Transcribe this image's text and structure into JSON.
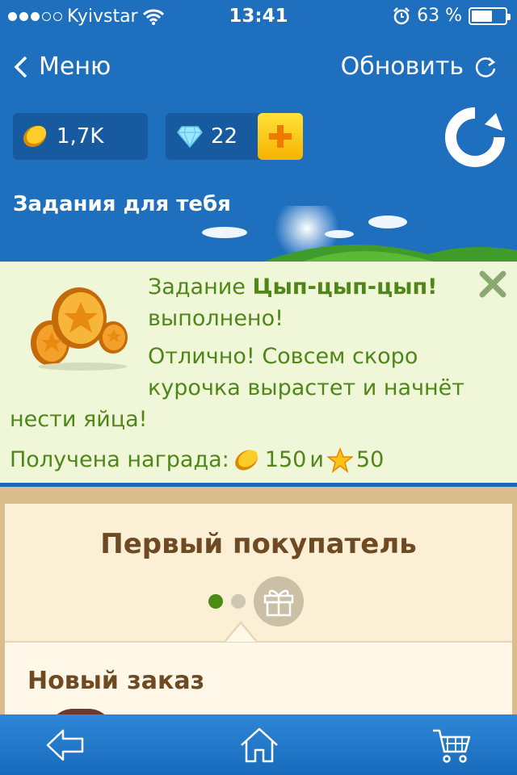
{
  "status": {
    "carrier": "Kyivstar",
    "time": "13:41",
    "battery": "63 %",
    "battery_level": 0.63
  },
  "nav": {
    "back_label": "Меню",
    "refresh_label": "Обновить"
  },
  "currency": {
    "coins": "1,7K",
    "gems": "22"
  },
  "section": {
    "title": "Задания для тебя"
  },
  "task": {
    "line1_prefix": "Задание ",
    "line1_name": "Цып-цып-цып!",
    "line1_suffix": "выполнено!",
    "line2": "Отлично! Совсем скоро курочка вырастет и начнёт",
    "line3": "нести яйца!",
    "reward_label": "Получена награда:",
    "reward_coins": "150",
    "reward_and": "и",
    "reward_stars": "50"
  },
  "card": {
    "title": "Первый покупатель",
    "order_title": "Новый заказ"
  },
  "colors": {
    "blue": "#1f6fbf",
    "green_text": "#4f8618",
    "brown_text": "#6e4a22"
  }
}
